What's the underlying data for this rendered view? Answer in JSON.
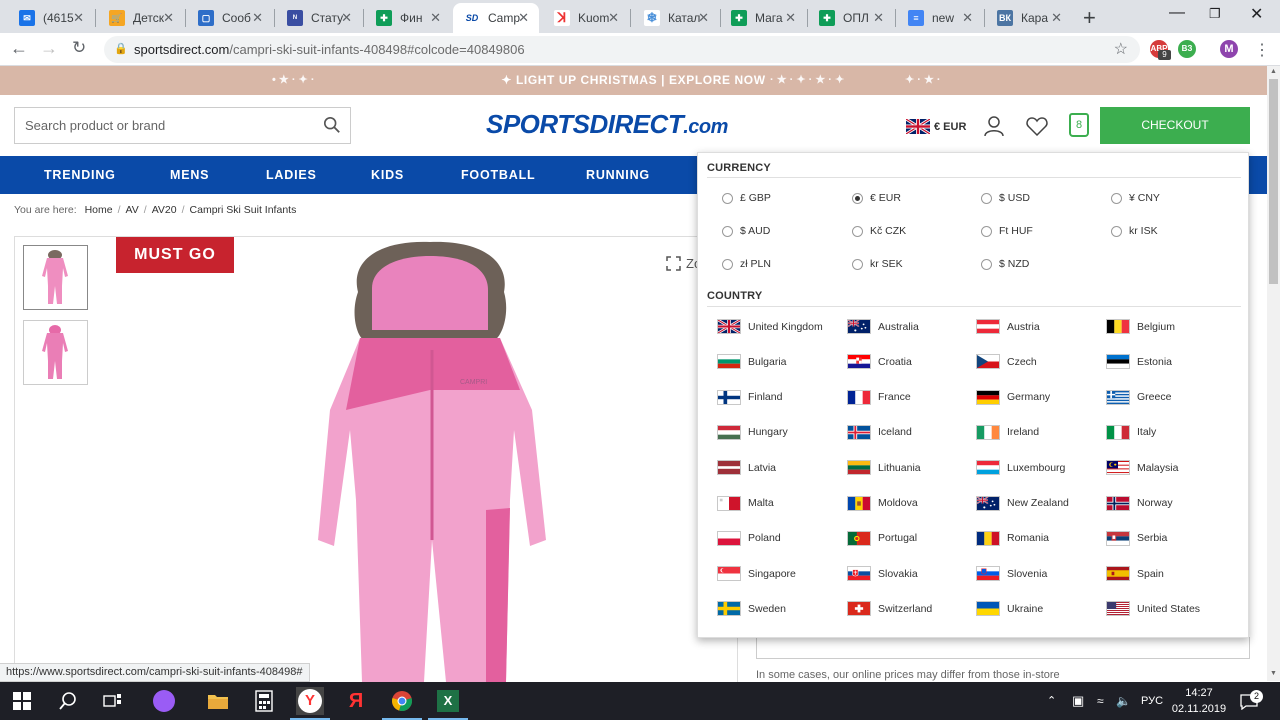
{
  "browser": {
    "tabs": [
      {
        "title": "(4615",
        "icon": "mail-icon",
        "color": "#1a73e8",
        "glyph": "✉"
      },
      {
        "title": "Детск",
        "icon": "cart-icon",
        "color": "#f5a623",
        "glyph": "🛒"
      },
      {
        "title": "Сооб",
        "icon": "chat-icon",
        "color": "#2e6ec8",
        "glyph": "▢"
      },
      {
        "title": "Стату",
        "icon": "news-icon",
        "color": "#3a4ea2",
        "glyph": "ᴺ"
      },
      {
        "title": "Фин",
        "icon": "sheets-icon",
        "color": "#0f9d58",
        "glyph": "✚"
      },
      {
        "title": "Camp",
        "icon": "sportsdirect-icon",
        "color": "#ffffff",
        "glyph": "SD",
        "active": true
      },
      {
        "title": "Kuom",
        "icon": "kuoma-icon",
        "color": "#ffffff",
        "glyph": "ꓘ"
      },
      {
        "title": "Катал",
        "icon": "snowflake-icon",
        "color": "#ffffff",
        "glyph": "❄"
      },
      {
        "title": "Мага",
        "icon": "sheets-icon",
        "color": "#0f9d58",
        "glyph": "✚"
      },
      {
        "title": "ОПЛ",
        "icon": "sheets-icon",
        "color": "#0f9d58",
        "glyph": "✚"
      },
      {
        "title": "new",
        "icon": "docs-icon",
        "color": "#4285f4",
        "glyph": "≡"
      },
      {
        "title": "Кара",
        "icon": "vk-icon",
        "color": "#4c75a3",
        "glyph": "ВК"
      }
    ],
    "new_tab": "+",
    "address": {
      "host": "sportsdirect.com",
      "path": "/campri-ski-suit-infants-408498#colcode=40849806"
    },
    "ext_badge": "9",
    "ext_label": "ВЗ",
    "profile": "M",
    "status_url": "https://www.sportsdirect.com/campri-ski-suit-infants-408498#"
  },
  "promo": {
    "text": "LIGHT UP CHRISTMAS | EXPLORE NOW"
  },
  "header": {
    "search_placeholder": "Search product or brand",
    "logo_main": "SPORTSDIRECT",
    "logo_tail": ".com",
    "currency_label": "€ EUR",
    "bag_count": "8",
    "checkout_label": "CHECKOUT"
  },
  "nav": {
    "items": [
      "TRENDING",
      "MENS",
      "LADIES",
      "KIDS",
      "FOOTBALL",
      "RUNNING"
    ]
  },
  "breadcrumb": {
    "prefix": "You are here:",
    "items": [
      "Home",
      "AV",
      "AV20",
      "Campri Ski Suit Infants"
    ]
  },
  "product": {
    "badge": "MUST GO",
    "zoom_label": "Zo",
    "price_note": "In some cases, our online prices may differ from those in-store"
  },
  "dropdown": {
    "currency_heading": "CURRENCY",
    "country_heading": "COUNTRY",
    "currencies": [
      {
        "label": "£ GBP",
        "selected": false
      },
      {
        "label": "€ EUR",
        "selected": true
      },
      {
        "label": "$ USD",
        "selected": false
      },
      {
        "label": "¥ CNY",
        "selected": false
      },
      {
        "label": "$ AUD",
        "selected": false
      },
      {
        "label": "Kč CZK",
        "selected": false
      },
      {
        "label": "Ft HUF",
        "selected": false
      },
      {
        "label": "kr ISK",
        "selected": false
      },
      {
        "label": "zł PLN",
        "selected": false
      },
      {
        "label": "kr SEK",
        "selected": false
      },
      {
        "label": "$ NZD",
        "selected": false
      }
    ],
    "countries": [
      "United Kingdom",
      "Australia",
      "Austria",
      "Belgium",
      "Bulgaria",
      "Croatia",
      "Czech",
      "Estonia",
      "Finland",
      "France",
      "Germany",
      "Greece",
      "Hungary",
      "Iceland",
      "Ireland",
      "Italy",
      "Latvia",
      "Lithuania",
      "Luxembourg",
      "Malaysia",
      "Malta",
      "Moldova",
      "New Zealand",
      "Norway",
      "Poland",
      "Portugal",
      "Romania",
      "Serbia",
      "Singapore",
      "Slovakia",
      "Slovenia",
      "Spain",
      "Sweden",
      "Switzerland",
      "Ukraine",
      "United States"
    ]
  },
  "taskbar": {
    "language": "РУС",
    "time": "14:27",
    "date": "02.11.2019",
    "notifications": "2"
  },
  "colors": {
    "brand_blue": "#0a4aa8",
    "checkout_green": "#3cae4f",
    "must_go_red": "#c7232e",
    "promo_bg": "#d8b7a7"
  }
}
